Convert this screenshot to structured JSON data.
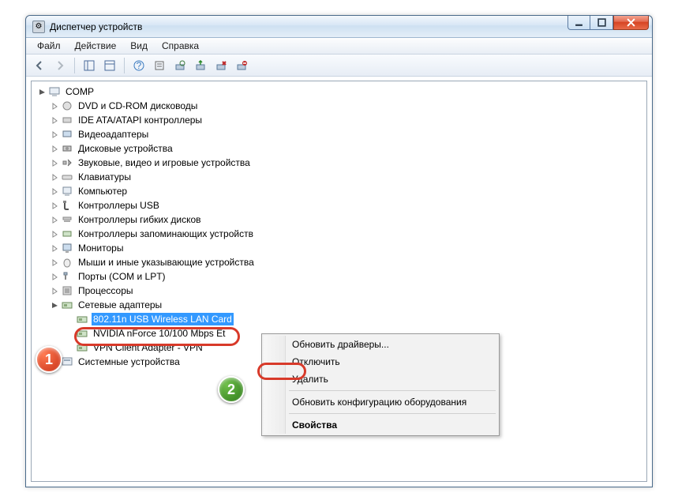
{
  "window": {
    "title": "Диспетчер устройств"
  },
  "menu": {
    "file": "Файл",
    "action": "Действие",
    "view": "Вид",
    "help": "Справка"
  },
  "tree": {
    "root": "COMP",
    "items": [
      {
        "label": "DVD и CD-ROM дисководы"
      },
      {
        "label": "IDE ATA/ATAPI контроллеры"
      },
      {
        "label": "Видеоадаптеры"
      },
      {
        "label": "Дисковые устройства"
      },
      {
        "label": "Звуковые, видео и игровые устройства"
      },
      {
        "label": "Клавиатуры"
      },
      {
        "label": "Компьютер"
      },
      {
        "label": "Контроллеры USB"
      },
      {
        "label": "Контроллеры гибких дисков"
      },
      {
        "label": "Контроллеры запоминающих устройств"
      },
      {
        "label": "Мониторы"
      },
      {
        "label": "Мыши и иные указывающие устройства"
      },
      {
        "label": "Порты (COM и LPT)"
      },
      {
        "label": "Процессоры"
      },
      {
        "label": "Сетевые адаптеры"
      }
    ],
    "network_children": [
      {
        "label": "802.11n USB Wireless LAN Card",
        "selected": true
      },
      {
        "label": "NVIDIA nForce 10/100 Mbps Et"
      },
      {
        "label": "VPN Client Adapter - VPN"
      }
    ],
    "footer_item": {
      "label": "Системные устройства"
    }
  },
  "contextmenu": {
    "update": "Обновить драйверы...",
    "disable": "Отключить",
    "delete": "Удалить",
    "rescan": "Обновить конфигурацию оборудования",
    "properties": "Свойства"
  },
  "badges": {
    "one": "1",
    "two": "2"
  }
}
